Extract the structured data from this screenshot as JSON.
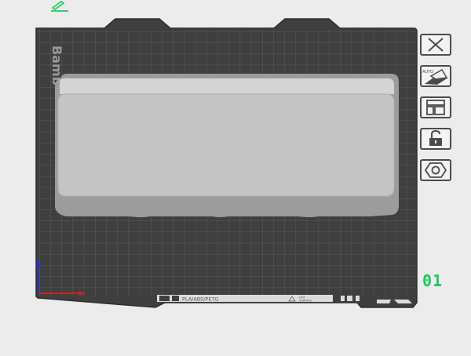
{
  "plate": {
    "brand_text": "Bamb",
    "plate_number": "01",
    "bottom_label": {
      "filament_types": "PLA/ABS/PETG",
      "surface_line1": "HOT",
      "surface_line2": "SURFACE"
    }
  },
  "toolbar": {
    "buttons": [
      {
        "name": "delete-plate-button",
        "icon": "close-x-icon"
      },
      {
        "name": "auto-orient-button",
        "icon": "auto-orient-icon",
        "icon_text": "AUTO"
      },
      {
        "name": "arrange-button",
        "icon": "arrange-icon"
      },
      {
        "name": "lock-plate-button",
        "icon": "unlocked-padlock-icon"
      },
      {
        "name": "plate-settings-button",
        "icon": "hexagon-nut-icon"
      }
    ]
  },
  "colors": {
    "background": "#ececec",
    "plate": "#3f3f3f",
    "grid": "#5a5a5a",
    "model_top": "#c4c4c4",
    "accent_green": "#1ec95a",
    "axis_x": "#cc2222",
    "axis_y": "#2233cc"
  }
}
